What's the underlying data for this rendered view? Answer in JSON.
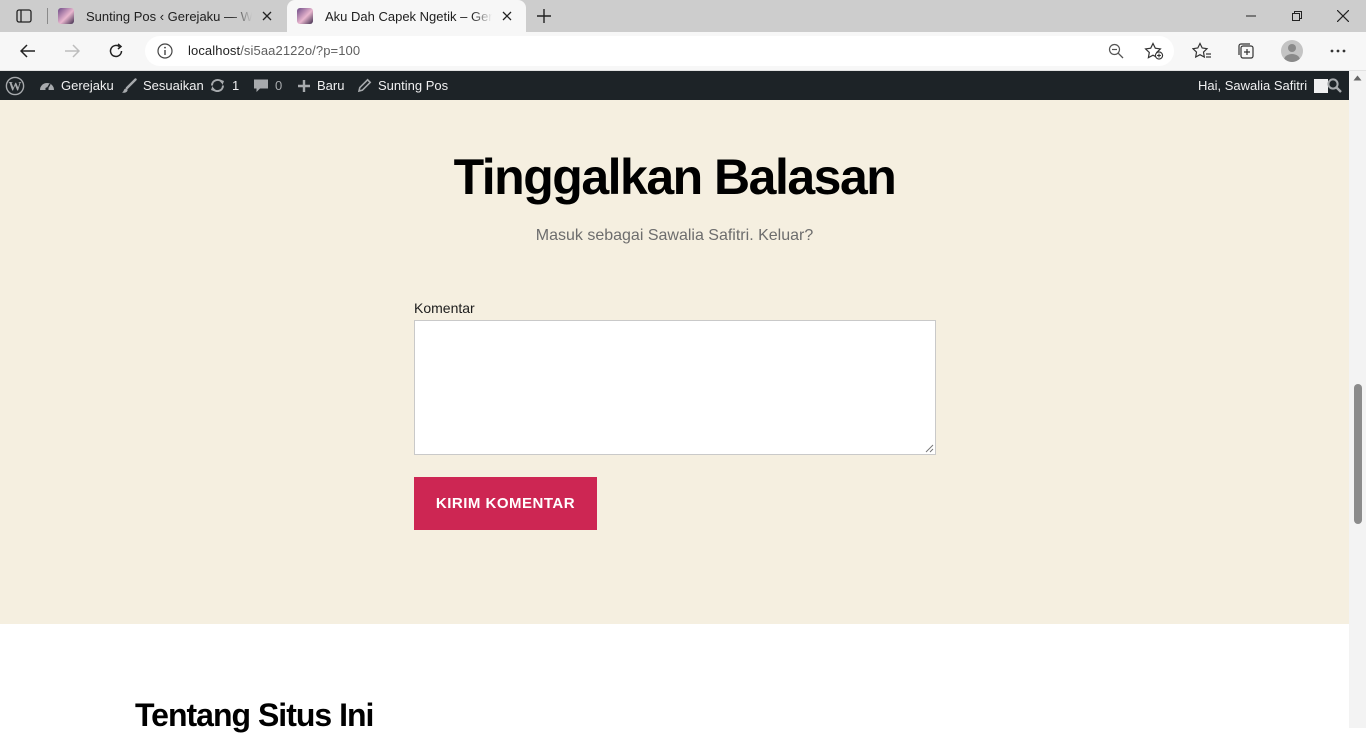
{
  "browser": {
    "tabs": [
      {
        "title": "Sunting Pos ‹ Gerejaku — WordPress",
        "active": false
      },
      {
        "title": "Aku Dah Capek Ngetik – Gerejaku",
        "active": true
      }
    ],
    "url_host": "localhost",
    "url_path": "/si5aa2122o/?p=100"
  },
  "adminbar": {
    "site_name": "Gerejaku",
    "customize": "Sesuaikan",
    "updates_count": "1",
    "comments_count": "0",
    "new": "Baru",
    "edit_post": "Sunting Pos",
    "greeting": "Hai, Sawalia Safitri"
  },
  "comment_form": {
    "title": "Tinggalkan Balasan",
    "logged_in_prefix": "Masuk sebagai ",
    "user_name": "Sawalia Safitri",
    "separator": ". ",
    "logout": "Keluar?",
    "comment_label": "Komentar",
    "comment_value": "",
    "submit_label": "KIRIM KOMENTAR"
  },
  "footer": {
    "about_title": "Tentang Situs Ini"
  },
  "colors": {
    "accent": "#cd2653",
    "section_bg": "#f5efe0",
    "adminbar_bg": "#1d2327"
  }
}
